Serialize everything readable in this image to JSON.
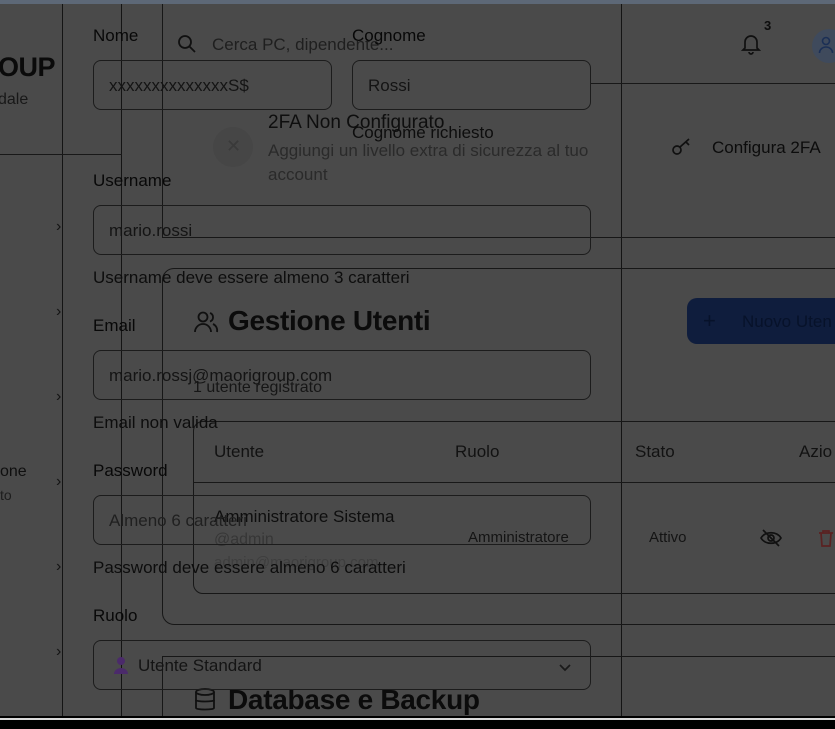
{
  "sidebar": {
    "logo_text": "OUP",
    "logo_sub": "dale",
    "nav_item_partial": "one",
    "nav_item_partial_sub": "to",
    "chevron": "›"
  },
  "header": {
    "search_placeholder": "Cerca PC, dipendente...",
    "notification_count": "3"
  },
  "twofa": {
    "title": "2FA Non Configurato",
    "description_line1": "Aggiungi un livello extra di sicurezza al tuo",
    "description_line2": "account",
    "configure_label": "Configura 2FA"
  },
  "users": {
    "title": "Gestione Utenti",
    "subtitle": "1 utente registrato",
    "new_button_label": "Nuovo Uten",
    "columns": [
      "Utente",
      "Ruolo",
      "Stato",
      "Azio"
    ],
    "rows": [
      {
        "name": "Amministratore Sistema",
        "handle": "@admin",
        "email": "admin@maorigroup.com",
        "role": "Amministratore",
        "status": "Attivo"
      }
    ]
  },
  "database": {
    "title": "Database e Backup"
  },
  "form": {
    "nome_label": "Nome",
    "nome_value": "xxxxxxxxxxxxxxS$",
    "cognome_label": "Cognome",
    "cognome_value": "Rossi",
    "cognome_error": "Cognome richiesto",
    "username_label": "Username",
    "username_value": "mario.rossi",
    "username_error": "Username deve essere almeno 3 caratteri",
    "email_label": "Email",
    "email_value": "mario.rossj@maorigroup.com",
    "email_error": "Email non valida",
    "password_label": "Password",
    "password_placeholder": "Almeno 6 caratteri",
    "password_error": "Password deve essere almeno 6 caratteri",
    "ruolo_label": "Ruolo",
    "ruolo_value": "Utente Standard"
  },
  "icons": {
    "search": "search-icon",
    "bell": "bell-icon",
    "user": "user-icon",
    "close": "close-icon",
    "key": "key-icon",
    "users": "users-icon",
    "plus": "plus-icon",
    "eye_off": "eye-off-icon",
    "trash": "trash-icon",
    "database": "database-icon",
    "chevron_down": "chevron-down-icon",
    "role_person": "person-icon"
  },
  "colors": {
    "dim_overlay": "#4a4a4a",
    "primary_button": "#0f1d3d",
    "danger_icon": "#5a2222",
    "role_icon": "#4b2a6b"
  }
}
